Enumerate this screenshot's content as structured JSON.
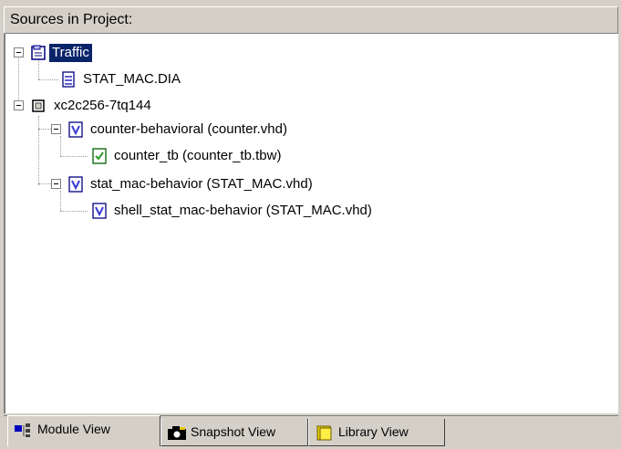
{
  "panel": {
    "title": "Sources in Project:"
  },
  "tree": {
    "traffic": "Traffic",
    "stat_mac_dia": "STAT_MAC.DIA",
    "device": "xc2c256-7tq144",
    "counter_behavioral": "counter-behavioral (counter.vhd)",
    "counter_tb": "counter_tb (counter_tb.tbw)",
    "stat_mac_behavior": "stat_mac-behavior (STAT_MAC.vhd)",
    "shell_stat_mac_behavior": "shell_stat_mac-behavior (STAT_MAC.vhd)"
  },
  "tabs": {
    "module_view": "Module View",
    "snapshot_view": "Snapshot View",
    "library_view": "Library View"
  },
  "icons": {
    "project": "project-icon",
    "diagram_file": "diagram-file-icon",
    "chip": "chip-icon",
    "vhdl": "vhdl-module-icon",
    "testbench": "testbench-icon"
  },
  "colors": {
    "selection": "#0a246a",
    "vhdl_icon": "#3a3ad6",
    "testbench_icon": "#2a9a2a"
  }
}
